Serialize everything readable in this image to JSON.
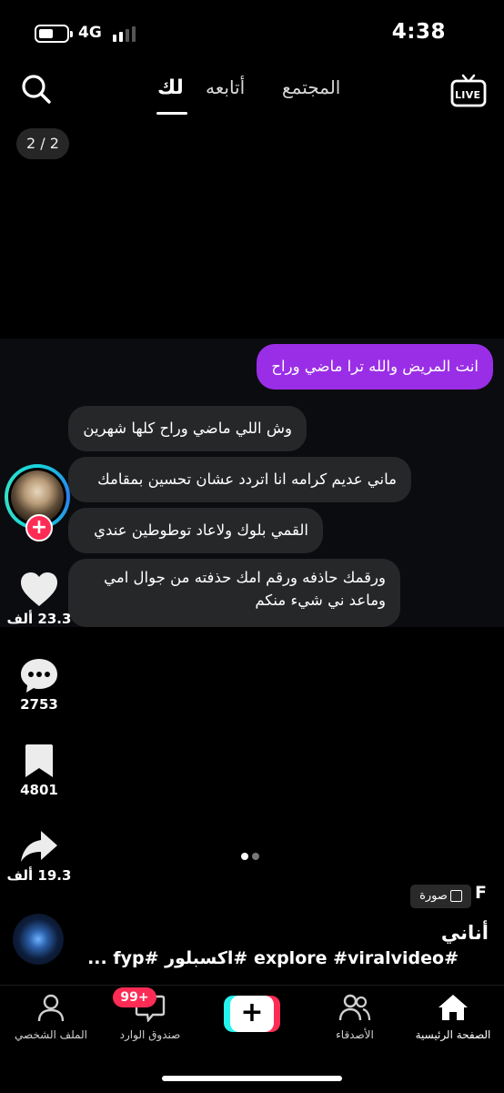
{
  "status_bar": {
    "time": "4:38",
    "network": "4G",
    "battery_level": 0.55,
    "signal_bars": 2
  },
  "top_nav": {
    "tabs": [
      {
        "label": "لك",
        "active": true
      },
      {
        "label": "أتابعه",
        "active": false
      },
      {
        "label": "المجتمع",
        "active": false
      }
    ],
    "live_label": "LIVE",
    "search_icon": "search-icon"
  },
  "photo_counter": "2 / 2",
  "chat": {
    "sent": [
      "انت المريض والله ترا ماضي وراح"
    ],
    "received": [
      "وش اللي ماضي وراح كلها شهرين",
      "ماني عديم كرامه انا اتردد عشان تحسين بمقامك",
      "القمي بلوك ولاعاد توطوطين عندي",
      "ورقمك حاذفه ورقم امك حذفته من جوال امي وماعد ني شيء منكم"
    ]
  },
  "actions": {
    "likes": "23.3 ألف",
    "comments": "2753",
    "saves": "4801",
    "shares": "19.3 ألف",
    "follow_symbol": "+"
  },
  "post": {
    "author_initial": "F",
    "badge_label": "صورة",
    "username": "أناني",
    "caption": "#explore #viralvideo #اكسبلور #fyp ..."
  },
  "bottom_nav": {
    "home": "الصفحة الرئيسية",
    "friends": "الأصدقاء",
    "create": "+",
    "inbox": "صندوق الوارد",
    "inbox_badge": "99+",
    "profile": "الملف الشخصي"
  },
  "colors": {
    "accent": "#fe2c55",
    "accent_alt": "#25f4ee",
    "sent_bubble": "#9a2ee6",
    "received_bubble": "#262729",
    "background": "#000000"
  }
}
